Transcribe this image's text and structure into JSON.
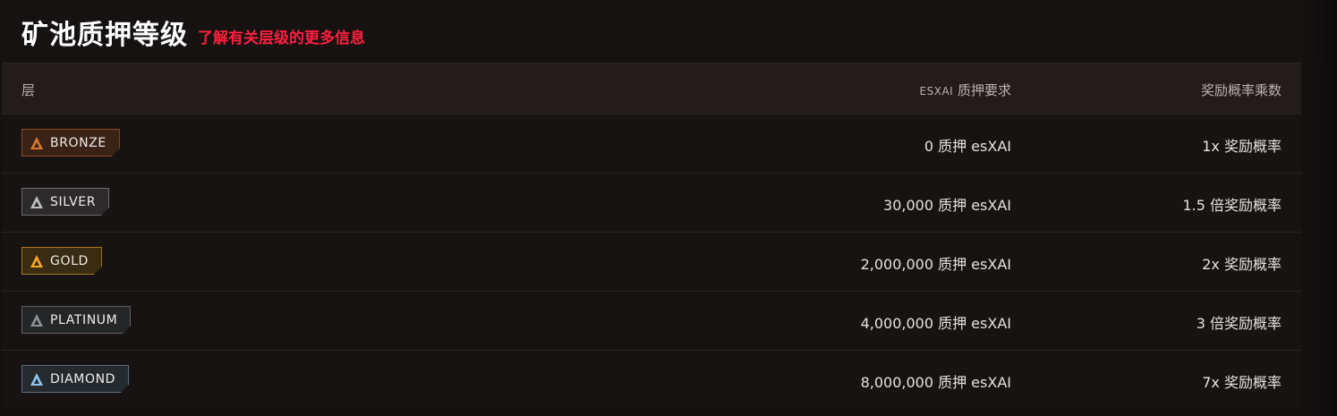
{
  "header": {
    "title": "矿池质押等级",
    "learn_more": "了解有关层级的更多信息"
  },
  "table": {
    "columns": {
      "tier": "层",
      "requirement_prefix": "ESXAI",
      "requirement": " 质押要求",
      "multiplier": "奖励概率乘数"
    },
    "rows": [
      {
        "tier": "BRONZE",
        "requirement": "0 质押 esXAI",
        "multiplier": "1x 奖励概率",
        "icon": "bronze-tier-icon",
        "color": "#d9772b"
      },
      {
        "tier": "SILVER",
        "requirement": "30,000 质押 esXAI",
        "multiplier": "1.5 倍奖励概率",
        "icon": "silver-tier-icon",
        "color": "#bdbdbd"
      },
      {
        "tier": "GOLD",
        "requirement": "2,000,000 质押 esXAI",
        "multiplier": "2x 奖励概率",
        "icon": "gold-tier-icon",
        "color": "#f5a623"
      },
      {
        "tier": "PLATINUM",
        "requirement": "4,000,000 质押 esXAI",
        "multiplier": "3 倍奖励概率",
        "icon": "platinum-tier-icon",
        "color": "#8e9399"
      },
      {
        "tier": "DIAMOND",
        "requirement": "8,000,000 质押 esXAI",
        "multiplier": "7x 奖励概率",
        "icon": "diamond-tier-icon",
        "color": "#8fc4ec"
      }
    ]
  },
  "colors": {
    "background": "#151111",
    "accent_link": "#ff1f3d"
  }
}
